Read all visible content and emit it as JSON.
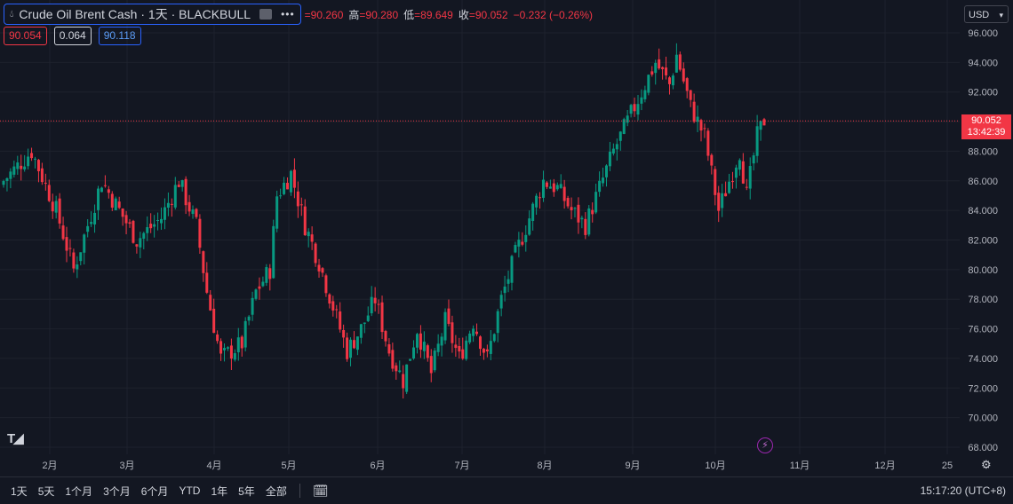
{
  "header": {
    "symbol_title": "Crude Oil Brent Cash · 1天 · BLACKBULL",
    "more_label": "•••",
    "ohlc": [
      {
        "label": "",
        "value": "=90.260"
      },
      {
        "label": "高",
        "value": "=90.280"
      },
      {
        "label": "低",
        "value": "=89.649"
      },
      {
        "label": "收",
        "value": "=90.052"
      },
      {
        "label": "",
        "value": "−0.232 (−0.26%)"
      }
    ]
  },
  "quote": {
    "bid": "90.054",
    "spread": "0.064",
    "ask": "90.118"
  },
  "currency": "USD",
  "last_price": {
    "value": "90.052",
    "countdown": "13:42:39"
  },
  "footer": {
    "ranges": [
      "1天",
      "5天",
      "1个月",
      "3个月",
      "6个月",
      "YTD",
      "1年",
      "5年",
      "全部"
    ],
    "time": "15:17:20 (UTC+8)"
  },
  "colors": {
    "up": "#089981",
    "down": "#f23645",
    "background": "#131722",
    "accent": "#2962ff"
  },
  "icons": {
    "logo": "tradingview-logo-icon",
    "bolt": "lightning-icon",
    "settings": "gear-icon",
    "calendar": "calendar-range-icon"
  },
  "chart_data": {
    "type": "candlestick",
    "y_ticks": [
      "96.000",
      "94.000",
      "92.000",
      "90.000",
      "88.000",
      "86.000",
      "84.000",
      "82.000",
      "80.000",
      "78.000",
      "76.000",
      "74.000",
      "72.000",
      "70.000",
      "68.000"
    ],
    "ylim": [
      68,
      96
    ],
    "x_ticks": [
      "2月",
      "3月",
      "4月",
      "5月",
      "6月",
      "7月",
      "8月",
      "9月",
      "10月",
      "11月",
      "12月",
      "25"
    ],
    "waypoints": [
      [
        0,
        86.0
      ],
      [
        8,
        88.0
      ],
      [
        15,
        84.0
      ],
      [
        20,
        80.0
      ],
      [
        28,
        86.0
      ],
      [
        38,
        82.0
      ],
      [
        45,
        83.5
      ],
      [
        50,
        86.0
      ],
      [
        55,
        83.0
      ],
      [
        58,
        78.5
      ],
      [
        62,
        74.0
      ],
      [
        68,
        75.0
      ],
      [
        72,
        78.5
      ],
      [
        76,
        80.0
      ],
      [
        78,
        85.0
      ],
      [
        82,
        86.5
      ],
      [
        86,
        83.0
      ],
      [
        90,
        80.5
      ],
      [
        94,
        77.5
      ],
      [
        98,
        74.5
      ],
      [
        102,
        76.0
      ],
      [
        106,
        78.0
      ],
      [
        110,
        74.5
      ],
      [
        114,
        72.5
      ],
      [
        118,
        76.0
      ],
      [
        122,
        73.0
      ],
      [
        126,
        76.5
      ],
      [
        130,
        74.0
      ],
      [
        134,
        76.5
      ],
      [
        138,
        74.0
      ],
      [
        142,
        78.0
      ],
      [
        146,
        81.0
      ],
      [
        150,
        83.5
      ],
      [
        154,
        86.0
      ],
      [
        158,
        85.5
      ],
      [
        162,
        84.0
      ],
      [
        166,
        83.0
      ],
      [
        170,
        85.5
      ],
      [
        174,
        88.0
      ],
      [
        178,
        90.0
      ],
      [
        182,
        92.0
      ],
      [
        186,
        94.0
      ],
      [
        190,
        92.5
      ],
      [
        192,
        94.5
      ],
      [
        196,
        91.0
      ],
      [
        200,
        89.0
      ],
      [
        204,
        84.0
      ],
      [
        207,
        86.0
      ],
      [
        210,
        88.0
      ],
      [
        212,
        85.0
      ],
      [
        215,
        89.0
      ],
      [
        217,
        90.1
      ]
    ]
  }
}
